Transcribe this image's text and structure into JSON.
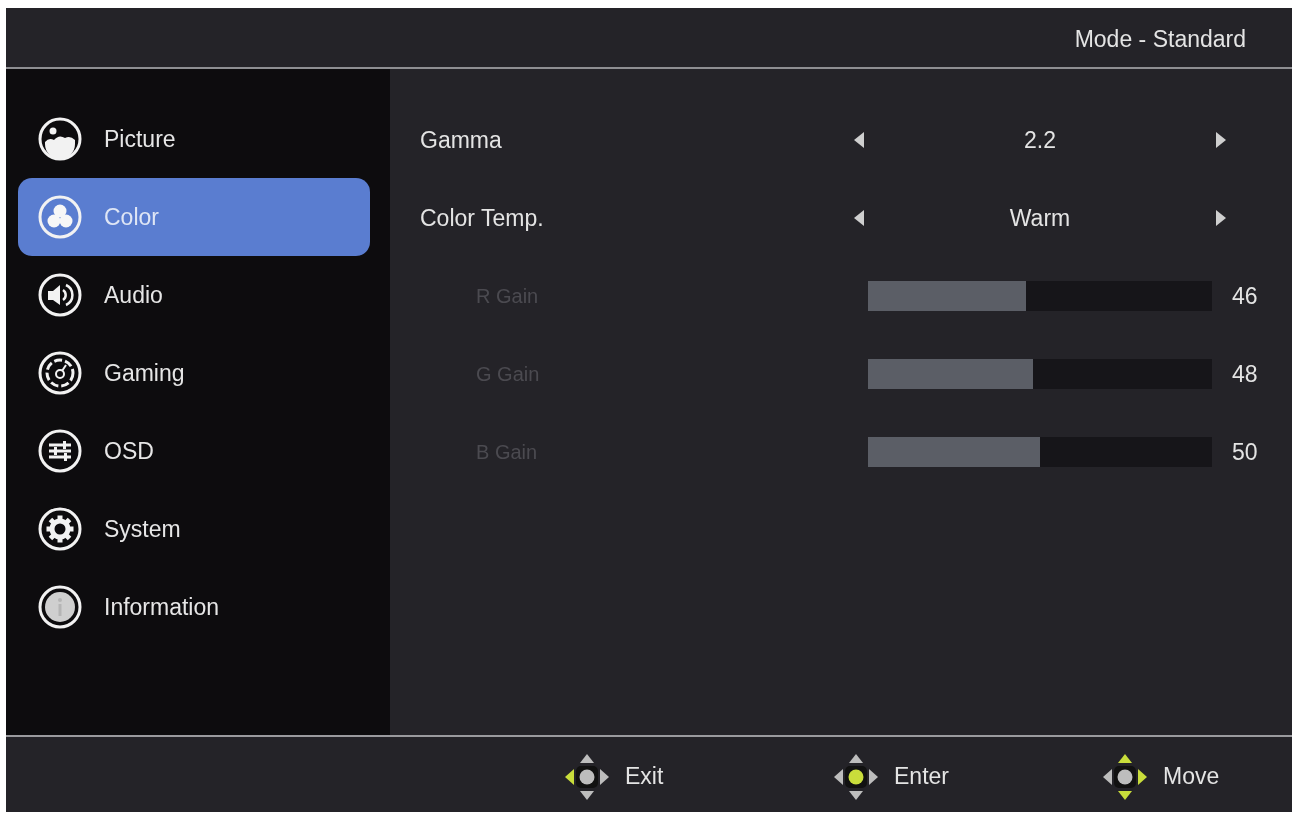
{
  "header": {
    "mode": "Mode - Standard"
  },
  "sidebar": {
    "items": [
      {
        "label": "Picture",
        "selected": false
      },
      {
        "label": "Color",
        "selected": true
      },
      {
        "label": "Audio",
        "selected": false
      },
      {
        "label": "Gaming",
        "selected": false
      },
      {
        "label": "OSD",
        "selected": false
      },
      {
        "label": "System",
        "selected": false
      },
      {
        "label": "Information",
        "selected": false
      }
    ]
  },
  "content": {
    "rows": [
      {
        "kind": "option",
        "label": "Gamma",
        "value": "2.2",
        "disabled": false
      },
      {
        "kind": "option",
        "label": "Color Temp.",
        "value": "Warm",
        "disabled": false
      },
      {
        "kind": "slider",
        "label": "R Gain",
        "level": 0.46,
        "value": "46",
        "disabled": true
      },
      {
        "kind": "slider",
        "label": "G Gain",
        "level": 0.48,
        "value": "48",
        "disabled": true
      },
      {
        "kind": "slider",
        "label": "B Gain",
        "level": 0.5,
        "value": "50",
        "disabled": true
      }
    ]
  },
  "footer": {
    "hints": [
      {
        "label": "Exit",
        "lit": {
          "up": false,
          "down": false,
          "left": true,
          "right": false,
          "center": false
        }
      },
      {
        "label": "Enter",
        "lit": {
          "up": false,
          "down": false,
          "left": false,
          "right": false,
          "center": true
        }
      },
      {
        "label": "Move",
        "lit": {
          "up": true,
          "down": true,
          "left": false,
          "right": true,
          "center": false
        }
      }
    ]
  }
}
